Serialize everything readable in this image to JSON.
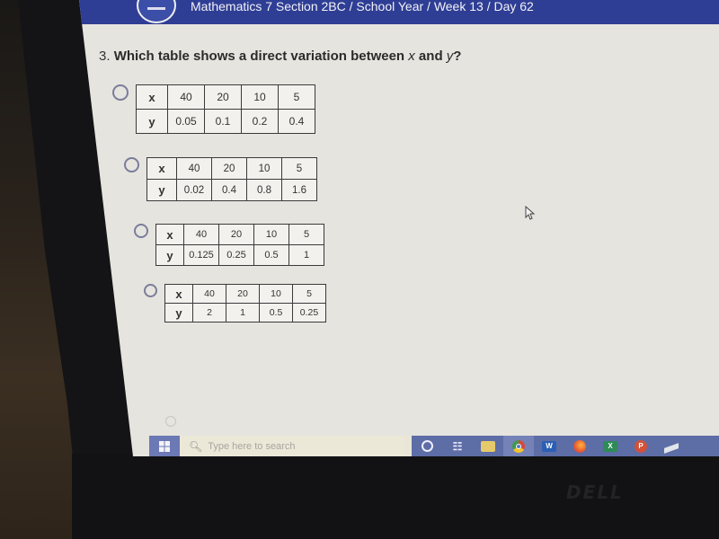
{
  "header": {
    "breadcrumb": "Mathematics 7 Section 2BC / School Year / Week 13 / Day 62"
  },
  "question": {
    "number": "3.",
    "text_before": "Which table shows a direct variation between ",
    "var_x": "x",
    "text_mid": " and ",
    "var_y": "y",
    "text_after": "?"
  },
  "options": [
    {
      "x_label": "x",
      "y_label": "y",
      "x": [
        "40",
        "20",
        "10",
        "5"
      ],
      "y": [
        "0.05",
        "0.1",
        "0.2",
        "0.4"
      ]
    },
    {
      "x_label": "x",
      "y_label": "y",
      "x": [
        "40",
        "20",
        "10",
        "5"
      ],
      "y": [
        "0.02",
        "0.4",
        "0.8",
        "1.6"
      ]
    },
    {
      "x_label": "x",
      "y_label": "y",
      "x": [
        "40",
        "20",
        "10",
        "5"
      ],
      "y": [
        "0.125",
        "0.25",
        "0.5",
        "1"
      ]
    },
    {
      "x_label": "x",
      "y_label": "y",
      "x": [
        "40",
        "20",
        "10",
        "5"
      ],
      "y": [
        "2",
        "1",
        "0.5",
        "0.25"
      ]
    }
  ],
  "taskbar": {
    "search_placeholder": "Type here to search",
    "icons": [
      "cortana-icon",
      "task-view-icon",
      "file-explorer-icon",
      "chrome-icon",
      "word-icon",
      "firefox-icon",
      "excel-icon",
      "powerpoint-icon",
      "scanner-icon"
    ],
    "word_letter": "W",
    "excel_letter": "X",
    "ppt_letter": "P"
  },
  "bezel": {
    "brand": "DELL"
  },
  "colors": {
    "header_bg": "#2f3e95",
    "page_bg": "#e6e4df",
    "radio_border": "#7a7d9a",
    "taskbar_bg": "#5d6da6"
  }
}
